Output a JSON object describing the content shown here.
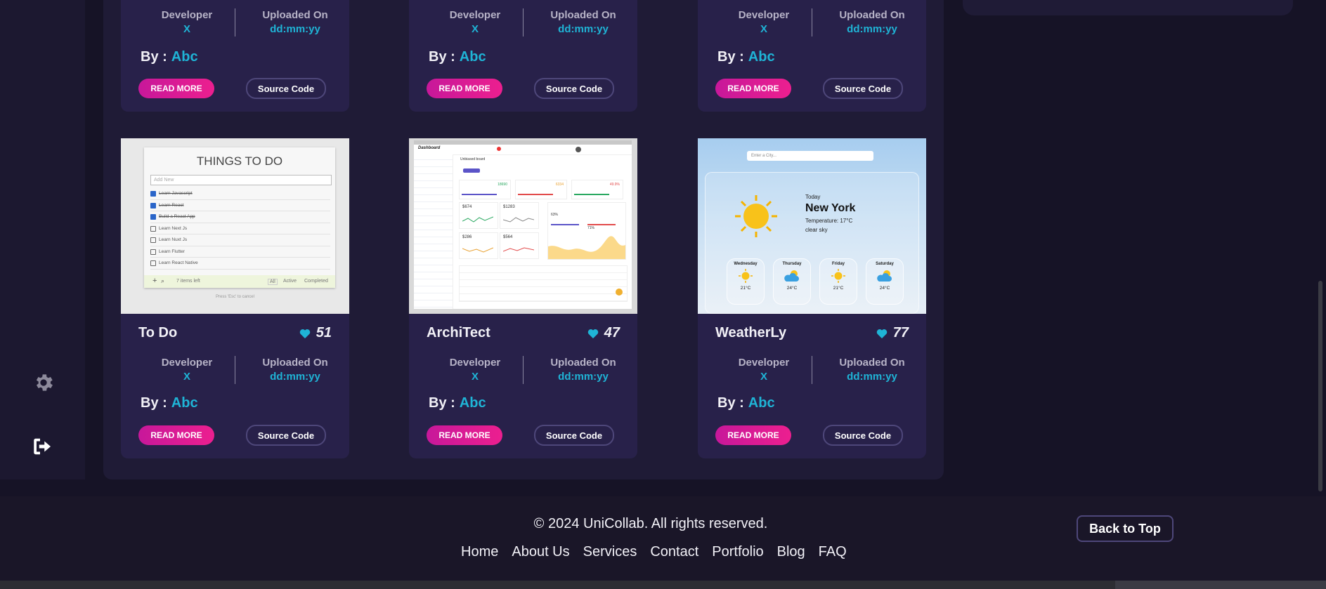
{
  "sidebar": {
    "icons": [
      "gear-icon",
      "logout-icon"
    ]
  },
  "top_cards": [
    {
      "developer_label": "Developer",
      "developer_value": "X",
      "uploaded_label": "Uploaded On",
      "uploaded_value": "dd:mm:yy",
      "by_label": "By :",
      "by_value": "Abc",
      "read_more": "READ MORE",
      "source_code": "Source Code"
    },
    {
      "developer_label": "Developer",
      "developer_value": "X",
      "uploaded_label": "Uploaded On",
      "uploaded_value": "dd:mm:yy",
      "by_label": "By :",
      "by_value": "Abc",
      "read_more": "READ MORE",
      "source_code": "Source Code"
    },
    {
      "developer_label": "Developer",
      "developer_value": "X",
      "uploaded_label": "Uploaded On",
      "uploaded_value": "dd:mm:yy",
      "by_label": "By :",
      "by_value": "Abc",
      "read_more": "READ MORE",
      "source_code": "Source Code"
    }
  ],
  "cards": [
    {
      "title": "To Do",
      "likes": "51",
      "developer_label": "Developer",
      "developer_value": "X",
      "uploaded_label": "Uploaded On",
      "uploaded_value": "dd:mm:yy",
      "by_label": "By :",
      "by_value": "Abc",
      "read_more": "READ MORE",
      "source_code": "Source Code",
      "preview": {
        "heading": "THINGS TO DO",
        "placeholder": "Add New",
        "tasks": [
          "Learn Javascript",
          "Learn React",
          "Build a React App",
          "Learn Next Js",
          "Learn Nuxt Js",
          "Learn Flutter",
          "Learn React Native"
        ],
        "items_left": "7 items left",
        "filters": [
          "All",
          "Active",
          "Completed"
        ],
        "hint": "Press 'Esc' to cancel"
      }
    },
    {
      "title": "ArchiTect",
      "likes": "47",
      "developer_label": "Developer",
      "developer_value": "X",
      "uploaded_label": "Uploaded On",
      "uploaded_value": "dd:mm:yy",
      "by_label": "By :",
      "by_value": "Abc",
      "read_more": "READ MORE",
      "source_code": "Source Code",
      "preview": {
        "logo": "Dashboard",
        "page": "Unbiased board",
        "stats": [
          "$674",
          "$1283",
          "$286",
          "$564"
        ],
        "kpi": [
          "18690",
          "6334",
          "49.9%"
        ],
        "pct": [
          "63%",
          "71%"
        ]
      }
    },
    {
      "title": "WeatherLy",
      "likes": "77",
      "developer_label": "Developer",
      "developer_value": "X",
      "uploaded_label": "Uploaded On",
      "uploaded_value": "dd:mm:yy",
      "by_label": "By :",
      "by_value": "Abc",
      "read_more": "READ MORE",
      "source_code": "Source Code",
      "preview": {
        "search_placeholder": "Enter a City...",
        "day": "Today",
        "city": "New York",
        "temperature": "Temperature: 17°C",
        "condition": "clear sky",
        "forecast": [
          {
            "day": "Wednesday",
            "temp": "21°C"
          },
          {
            "day": "Thursday",
            "temp": "24°C"
          },
          {
            "day": "Friday",
            "temp": "21°C"
          },
          {
            "day": "Saturday",
            "temp": "24°C"
          }
        ]
      }
    }
  ],
  "footer": {
    "copyright": "© 2024 UniCollab. All rights reserved.",
    "links": [
      "Home",
      "About Us",
      "Services",
      "Contact",
      "Portfolio",
      "Blog",
      "FAQ"
    ],
    "back_to_top": "Back to Top"
  },
  "colors": {
    "accent_cyan": "#1fb4d6",
    "accent_pink": "#e91e8c",
    "card_bg": "#28214a",
    "page_bg": "#161326"
  }
}
